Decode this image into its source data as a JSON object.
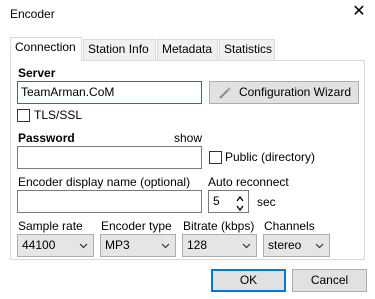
{
  "window": {
    "title": "Encoder",
    "close_label": "✕"
  },
  "tabs": [
    "Connection",
    "Station Info",
    "Metadata",
    "Statistics"
  ],
  "server": {
    "label": "Server",
    "value": "TeamArman.CoM",
    "wizard_button": "Configuration Wizard",
    "tls_label": "TLS/SSL"
  },
  "password": {
    "label": "Password",
    "show_link": "show",
    "value": "",
    "public_label": "Public (directory)"
  },
  "encoder_name": {
    "label": "Encoder display name (optional)",
    "value": ""
  },
  "auto_reconnect": {
    "label": "Auto reconnect",
    "value": "5",
    "unit": "sec"
  },
  "sample_rate": {
    "label": "Sample rate",
    "value": "44100"
  },
  "encoder_type": {
    "label": "Encoder type",
    "value": "MP3"
  },
  "bitrate": {
    "label": "Bitrate (kbps)",
    "value": "128"
  },
  "channels": {
    "label": "Channels",
    "value": "stereo"
  },
  "buttons": {
    "ok": "OK",
    "cancel": "Cancel"
  }
}
